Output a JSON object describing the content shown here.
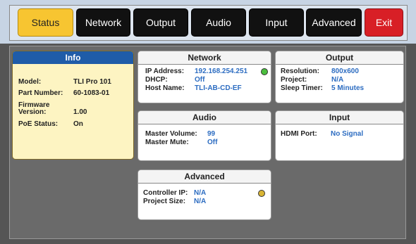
{
  "tabs": [
    {
      "label": "Status",
      "state": "active"
    },
    {
      "label": "Network"
    },
    {
      "label": "Output"
    },
    {
      "label": "Audio"
    },
    {
      "label": "Input"
    },
    {
      "label": "Advanced"
    },
    {
      "label": "Exit"
    }
  ],
  "info": {
    "title": "Info",
    "model_label": "Model:",
    "model_value": "TLI Pro 101",
    "part_label": "Part Number:",
    "part_value": "60-1083-01",
    "fw_label_1": "Firmware",
    "fw_label_2": "Version:",
    "fw_value": "1.00",
    "poe_label": "PoE Status:",
    "poe_value": "On"
  },
  "network": {
    "title": "Network",
    "ip_label": "IP Address:",
    "ip_value": "192.168.254.251",
    "dhcp_label": "DHCP:",
    "dhcp_value": "Off",
    "host_label": "Host Name:",
    "host_value": "TLI-AB-CD-EF",
    "status_color": "#4bbf3e"
  },
  "output": {
    "title": "Output",
    "res_label": "Resolution:",
    "res_value": "800x600",
    "proj_label": "Project:",
    "proj_value": "N/A",
    "sleep_label": "Sleep Timer:",
    "sleep_value": "5 Minutes"
  },
  "audio": {
    "title": "Audio",
    "vol_label": "Master Volume:",
    "vol_value": "99",
    "mute_label": "Master Mute:",
    "mute_value": "Off"
  },
  "input": {
    "title": "Input",
    "hdmi_label": "HDMI Port:",
    "hdmi_value": "No Signal"
  },
  "advanced": {
    "title": "Advanced",
    "ctrl_label": "Controller IP:",
    "ctrl_value": "N/A",
    "size_label": "Project Size:",
    "size_value": "N/A",
    "status_color": "#d9b534"
  },
  "colors": {
    "accent_active": "#f7c531",
    "exit": "#d81f26",
    "value_blue": "#2c6cc1",
    "info_header": "#1f5ca8"
  }
}
